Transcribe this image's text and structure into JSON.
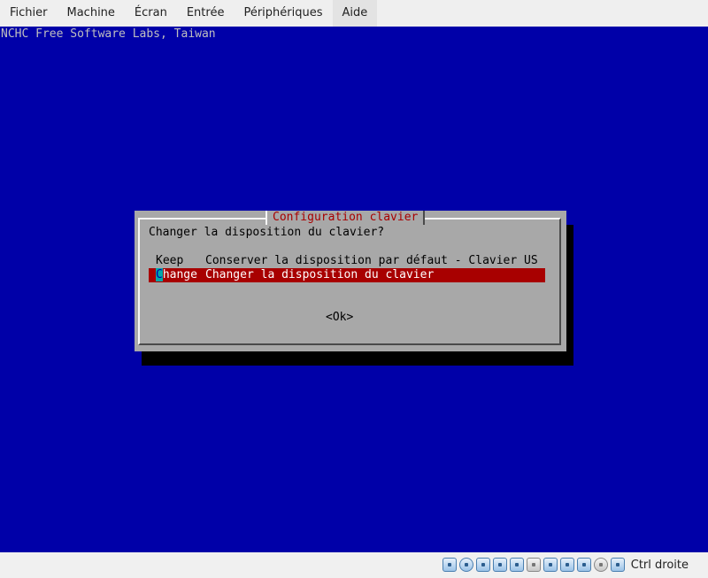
{
  "menubar": {
    "items": [
      {
        "label": "Fichier"
      },
      {
        "label": "Machine"
      },
      {
        "label": "Écran"
      },
      {
        "label": "Entrée"
      },
      {
        "label": "Périphériques"
      },
      {
        "label": "Aide"
      }
    ]
  },
  "console": {
    "backtitle": "NCHC Free Software Labs, Taiwan",
    "dialog": {
      "title": "Configuration clavier",
      "prompt": "Changer la disposition du clavier?",
      "options": [
        {
          "tag": "Keep",
          "description": "Conserver la disposition par défaut - Clavier US"
        },
        {
          "tag_hotkey": "C",
          "tag_rest": "hange",
          "description": "Changer la disposition du clavier",
          "selected": true
        }
      ],
      "ok_button": "<Ok>"
    },
    "colors": {
      "background": "#0000a8",
      "dialog": "#a8a8a8",
      "title": "#a80000",
      "highlight": "#a80000"
    }
  },
  "statusbar": {
    "icons": [
      "hard-disk-icon",
      "optical-drive-icon",
      "audio-icon",
      "network-icon",
      "usb-icon",
      "shared-folder-icon",
      "display-icon",
      "recording-icon",
      "virtualization-icon",
      "mouse-integration-icon",
      "keyboard-capture-icon"
    ],
    "host_key_label": "Ctrl droite"
  }
}
